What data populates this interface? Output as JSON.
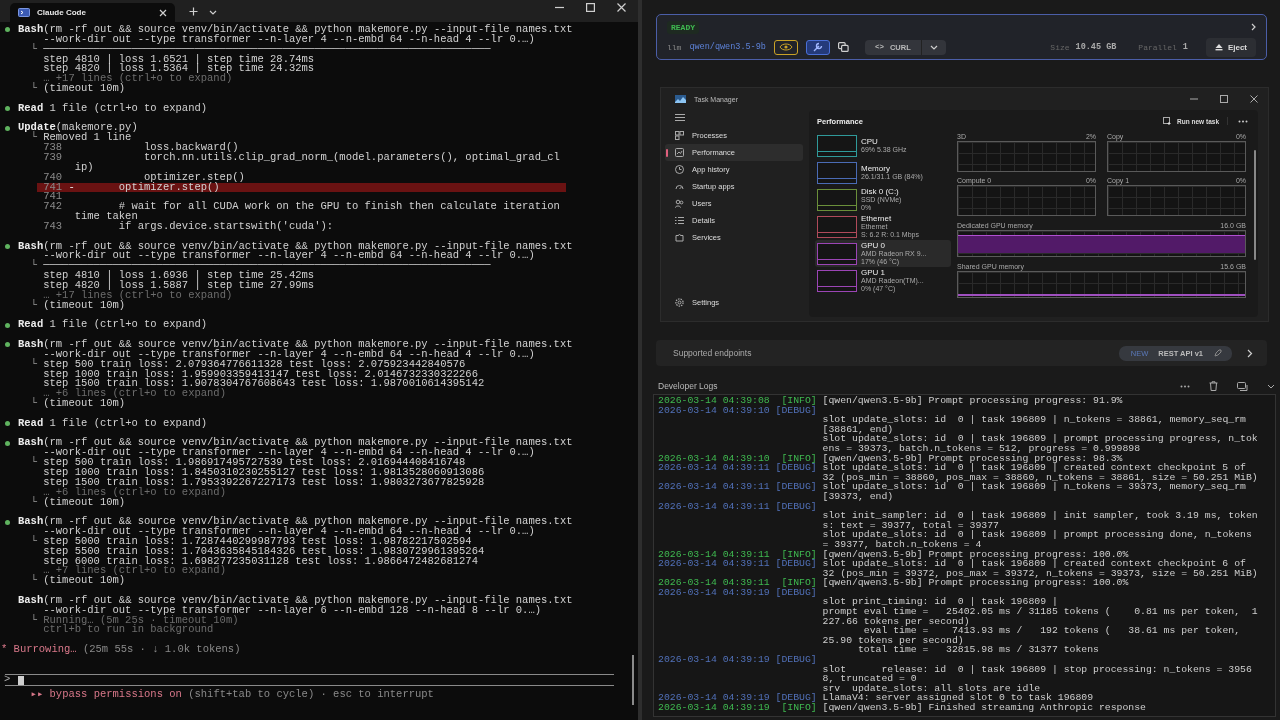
{
  "terminal": {
    "tab": {
      "title": "Claude Code"
    },
    "lines": [
      {
        "kind": "tool",
        "text": "**Bash**(rm -rf out && source venv/bin/activate && python makemore.py --input-file names.txt"
      },
      {
        "kind": "cont",
        "text": "--work-dir out --type transformer --n-layer 4 --n-embd 64 --n-head 4 --lr 0.…)"
      },
      {
        "kind": "out",
        "prefix": "└",
        "text": "───────────────────────────────────────────────────────────────────────"
      },
      {
        "kind": "out",
        "text": "step 4810 | loss 1.6521 | step time 28.74ms"
      },
      {
        "kind": "out",
        "text": "step 4820 | loss 1.5364 | step time 24.32ms"
      },
      {
        "kind": "dim",
        "text": "… +17 lines (ctrl+o to expand)"
      },
      {
        "kind": "out",
        "prefix": "└",
        "text": "(timeout 10m)"
      },
      {
        "kind": "blank"
      },
      {
        "kind": "tool",
        "text": "**Read** 1 file (ctrl+o to expand)"
      },
      {
        "kind": "blank"
      },
      {
        "kind": "tool",
        "text": "**Update**(makemore.py)"
      },
      {
        "kind": "out",
        "prefix": "└",
        "text": "Removed 1 line"
      },
      {
        "kind": "diff",
        "num": "738",
        "removed": false,
        "code": "           loss.backward()"
      },
      {
        "kind": "diff",
        "num": "739",
        "removed": false,
        "code": "           torch.nn.utils.clip_grad_norm_(model.parameters(), optimal_grad_cl"
      },
      {
        "kind": "wrap",
        "text": "ip)"
      },
      {
        "kind": "diff",
        "num": "740",
        "removed": false,
        "code": "           optimizer.step()"
      },
      {
        "kind": "diff",
        "num": "741",
        "removed": true,
        "sign": "-",
        "code": "       optimizer.step()"
      },
      {
        "kind": "diff",
        "num": "741",
        "removed": false
      },
      {
        "kind": "diff",
        "num": "742",
        "removed": false,
        "code": "       # wait for all CUDA work on the GPU to finish then calculate iteration"
      },
      {
        "kind": "wrap",
        "text": "time taken"
      },
      {
        "kind": "diff",
        "num": "743",
        "removed": false,
        "code": "       if args.device.startswith('cuda'):"
      },
      {
        "kind": "blank"
      },
      {
        "kind": "tool",
        "text": "**Bash**(rm -rf out && source venv/bin/activate && python makemore.py --input-file names.txt"
      },
      {
        "kind": "cont",
        "text": "--work-dir out --type transformer --n-layer 4 --n-embd 64 --n-head 4 --lr 0.…)"
      },
      {
        "kind": "out",
        "prefix": "└",
        "text": "───────────────────────────────────────────────────────────────────────"
      },
      {
        "kind": "out",
        "text": "step 4810 | loss 1.6936 | step time 25.42ms"
      },
      {
        "kind": "out",
        "text": "step 4820 | loss 1.5887 | step time 27.99ms"
      },
      {
        "kind": "dim",
        "text": "… +17 lines (ctrl+o to expand)"
      },
      {
        "kind": "out",
        "prefix": "└",
        "text": "(timeout 10m)"
      },
      {
        "kind": "blank"
      },
      {
        "kind": "tool",
        "text": "**Read** 1 file (ctrl+o to expand)"
      },
      {
        "kind": "blank"
      },
      {
        "kind": "tool",
        "text": "**Bash**(rm -rf out && source venv/bin/activate && python makemore.py --input-file names.txt"
      },
      {
        "kind": "cont",
        "text": "--work-dir out --type transformer --n-layer 4 --n-embd 64 --n-head 4 --lr 0.…)"
      },
      {
        "kind": "out",
        "prefix": "└",
        "text": "step 500 train loss: 2.079364776611328 test loss: 2.075923442840576"
      },
      {
        "kind": "out",
        "text": "step 1000 train loss: 1.959903359413147 test loss: 2.0146732330322266"
      },
      {
        "kind": "out",
        "text": "step 1500 train loss: 1.9078304767608643 test loss: 1.9870010614395142"
      },
      {
        "kind": "dim",
        "text": "… +6 lines (ctrl+o to expand)"
      },
      {
        "kind": "out",
        "prefix": "└",
        "text": "(timeout 10m)"
      },
      {
        "kind": "blank"
      },
      {
        "kind": "tool",
        "text": "**Read** 1 file (ctrl+o to expand)"
      },
      {
        "kind": "blank"
      },
      {
        "kind": "tool",
        "text": "**Bash**(rm -rf out && source venv/bin/activate && python makemore.py --input-file names.txt"
      },
      {
        "kind": "cont",
        "text": "--work-dir out --type transformer --n-layer 4 --n-embd 64 --n-head 4 --lr 0.…)"
      },
      {
        "kind": "out",
        "prefix": "└",
        "text": "step 500 train loss: 1.986917495727539 test loss: 2.016944408416748"
      },
      {
        "kind": "out",
        "text": "step 1000 train loss: 1.8450310230255127 test loss: 1.9813528060913086"
      },
      {
        "kind": "out",
        "text": "step 1500 train loss: 1.7953392267227173 test loss: 1.9803273677825928"
      },
      {
        "kind": "dim",
        "text": "… +6 lines (ctrl+o to expand)"
      },
      {
        "kind": "out",
        "prefix": "└",
        "text": "(timeout 10m)"
      },
      {
        "kind": "blank"
      },
      {
        "kind": "tool",
        "text": "**Bash**(rm -rf out && source venv/bin/activate && python makemore.py --input-file names.txt"
      },
      {
        "kind": "cont",
        "text": "--work-dir out --type transformer --n-layer 4 --n-embd 64 --n-head 4 --lr 0.…)"
      },
      {
        "kind": "out",
        "prefix": "└",
        "text": "step 5000 train loss: 1.7287440299987793 test loss: 1.98782217502594"
      },
      {
        "kind": "out",
        "text": "step 5500 train loss: 1.7043635845184326 test loss: 1.9830729961395264"
      },
      {
        "kind": "out",
        "text": "step 6000 train loss: 1.698277235031128 test loss: 1.9866472482681274"
      },
      {
        "kind": "dim",
        "text": "… +7 lines (ctrl+o to expand)"
      },
      {
        "kind": "out",
        "prefix": "└",
        "text": "(timeout 10m)"
      },
      {
        "kind": "blank"
      },
      {
        "kind": "tool_pending",
        "text": "**Bash**(rm -rf out && source venv/bin/activate && python makemore.py --input-file names.txt"
      },
      {
        "kind": "cont",
        "text": "--work-dir out --type transformer --n-layer 6 --n-embd 128 --n-head 8 --lr 0.…)"
      },
      {
        "kind": "dim",
        "prefix": "└",
        "text": "Running… (5m 25s · timeout 10m)"
      },
      {
        "kind": "dim",
        "text": "ctrl+b to run in background"
      },
      {
        "kind": "blank"
      }
    ],
    "status": {
      "icon": "*",
      "label": "Burrowing…",
      "detail": "(25m 55s · ↓ 1.0k tokens)"
    },
    "prompt": {
      "symbol": ">"
    },
    "footer": {
      "icon": "▸▸",
      "mode": "bypass permissions on",
      "hint": "(shift+tab to cycle) · esc to interrupt"
    }
  },
  "model_card": {
    "status": "READY",
    "type": "llm",
    "model": "qwen/qwen3.5-9b",
    "capabilities": [
      {
        "kind": "vision",
        "color": "#c9a227"
      },
      {
        "kind": "tools",
        "color": "#4a6fd6"
      }
    ],
    "curl_icon": "<>",
    "curl": "CURL",
    "size_label": "Size",
    "size": "10.45 GB",
    "parallel_label": "Parallel",
    "parallel": "1",
    "eject": "Eject"
  },
  "task_manager": {
    "title": "Task Manager",
    "nav": [
      {
        "kind": "processes",
        "label": "Processes",
        "selected": false
      },
      {
        "kind": "performance",
        "label": "Performance",
        "selected": true
      },
      {
        "kind": "history",
        "label": "App history",
        "selected": false
      },
      {
        "kind": "startup",
        "label": "Startup apps",
        "selected": false
      },
      {
        "kind": "users",
        "label": "Users",
        "selected": false
      },
      {
        "kind": "details",
        "label": "Details",
        "selected": false
      },
      {
        "kind": "services",
        "label": "Services",
        "selected": false
      }
    ],
    "settings": "Settings",
    "header": "Performance",
    "run_new_task": "Run new task",
    "devices": [
      {
        "name": "CPU",
        "lines": [
          "69% 5.38 GHz"
        ],
        "color": "#2f9a9a",
        "selected": false
      },
      {
        "name": "Memory",
        "lines": [
          "26.1/31.1 GB (84%)"
        ],
        "color": "#4a6bb5",
        "selected": false
      },
      {
        "name": "Disk 0 (C:)",
        "lines": [
          "SSD (NVMe)",
          "0%"
        ],
        "color": "#6a8f3a",
        "selected": false
      },
      {
        "name": "Ethernet",
        "lines": [
          "Ethernet",
          "S: 6.2 R: 0.1 Mbps"
        ],
        "color": "#b04a5a",
        "selected": false
      },
      {
        "name": "GPU 0",
        "lines": [
          "AMD Radeon RX 9...",
          "17% (46 °C)"
        ],
        "color": "#9b45b5",
        "selected": true
      },
      {
        "name": "GPU 1",
        "lines": [
          "AMD Radeon(TM)...",
          "0% (47 °C)"
        ],
        "color": "#9b45b5",
        "selected": false
      }
    ],
    "graphs": [
      {
        "label": "3D",
        "value": "2%"
      },
      {
        "label": "Copy",
        "value": "0%"
      },
      {
        "label": "Compute 0",
        "value": "0%"
      },
      {
        "label": "Copy 1",
        "value": "0%"
      }
    ],
    "memory": [
      {
        "kind": "dedicated",
        "label": "Dedicated GPU memory",
        "value": "16.0 GB"
      },
      {
        "kind": "shared",
        "label": "Shared GPU memory",
        "value": "15.6 GB"
      }
    ]
  },
  "endpoints": {
    "label": "Supported endpoints",
    "badge": "NEW",
    "api": "REST API v1"
  },
  "developer_logs": {
    "title": "Developer Logs",
    "entries": [
      {
        "kind": "info",
        "time": "2026-03-14 04:39:08",
        "level": "[INFO]",
        "newline": false,
        "lines": [
          "[qwen/qwen3.5-9b] Prompt processing progress: 91.9%"
        ]
      },
      {
        "kind": "debug",
        "time": "2026-03-14 04:39:10",
        "level": "[DEBUG]",
        "newline": true,
        "lines": [
          "slot update_slots: id  0 | task 196809 | n_tokens = 38861, memory_seq_rm",
          "[38861, end)",
          "slot update_slots: id  0 | task 196809 | prompt processing progress, n_tok",
          "ens = 39373, batch.n_tokens = 512, progress = 0.999898"
        ]
      },
      {
        "kind": "info",
        "time": "2026-03-14 04:39:10",
        "level": "[INFO]",
        "newline": false,
        "lines": [
          "[qwen/qwen3.5-9b] Prompt processing progress: 98.3%"
        ]
      },
      {
        "kind": "debug",
        "time": "2026-03-14 04:39:11",
        "level": "[DEBUG]",
        "newline": false,
        "lines": [
          "slot update_slots: id  0 | task 196809 | created context checkpoint 5 of",
          "32 (pos_min = 38860, pos_max = 38860, n_tokens = 38861, size = 50.251 MiB)"
        ]
      },
      {
        "kind": "debug",
        "time": "2026-03-14 04:39:11",
        "level": "[DEBUG]",
        "newline": false,
        "lines": [
          "slot update_slots: id  0 | task 196809 | n_tokens = 39373, memory_seq_rm",
          "[39373, end)"
        ]
      },
      {
        "kind": "debug",
        "time": "2026-03-14 04:39:11",
        "level": "[DEBUG]",
        "newline": true,
        "lines": [
          "slot init_sampler: id  0 | task 196809 | init sampler, took 3.19 ms, token",
          "s: text = 39377, total = 39377",
          "slot update_slots: id  0 | task 196809 | prompt processing done, n_tokens",
          "= 39377, batch.n_tokens = 4"
        ]
      },
      {
        "kind": "info",
        "time": "2026-03-14 04:39:11",
        "level": "[INFO]",
        "newline": false,
        "lines": [
          "[qwen/qwen3.5-9b] Prompt processing progress: 100.0%"
        ]
      },
      {
        "kind": "debug",
        "time": "2026-03-14 04:39:11",
        "level": "[DEBUG]",
        "newline": false,
        "lines": [
          "slot update_slots: id  0 | task 196809 | created context checkpoint 6 of",
          "32 (pos_min = 39372, pos_max = 39372, n_tokens = 39373, size = 50.251 MiB)"
        ]
      },
      {
        "kind": "info",
        "time": "2026-03-14 04:39:11",
        "level": "[INFO]",
        "newline": false,
        "lines": [
          "[qwen/qwen3.5-9b] Prompt processing progress: 100.0%"
        ]
      },
      {
        "kind": "debug",
        "time": "2026-03-14 04:39:19",
        "level": "[DEBUG]",
        "newline": true,
        "lines": [
          "slot print_timing: id  0 | task 196809 |",
          "prompt eval time =   25402.05 ms / 31185 tokens (    0.81 ms per token,  1",
          "227.66 tokens per second)",
          "       eval time =    7413.93 ms /   192 tokens (   38.61 ms per token,",
          "25.90 tokens per second)",
          "      total time =   32815.98 ms / 31377 tokens"
        ]
      },
      {
        "kind": "debug",
        "time": "2026-03-14 04:39:19",
        "level": "[DEBUG]",
        "newline": true,
        "lines": [
          "slot      release: id  0 | task 196809 | stop processing: n_tokens = 3956",
          "8, truncated = 0",
          "srv  update_slots: all slots are idle"
        ]
      },
      {
        "kind": "debug",
        "time": "2026-03-14 04:39:19",
        "level": "[DEBUG]",
        "newline": false,
        "lines": [
          "LlamaV4: server assigned slot 0 to task 196809"
        ]
      },
      {
        "kind": "info",
        "time": "2026-03-14 04:39:19",
        "level": "[INFO]",
        "newline": false,
        "lines": [
          "[qwen/qwen3.5-9b] Finished streaming Anthropic response"
        ]
      }
    ]
  }
}
